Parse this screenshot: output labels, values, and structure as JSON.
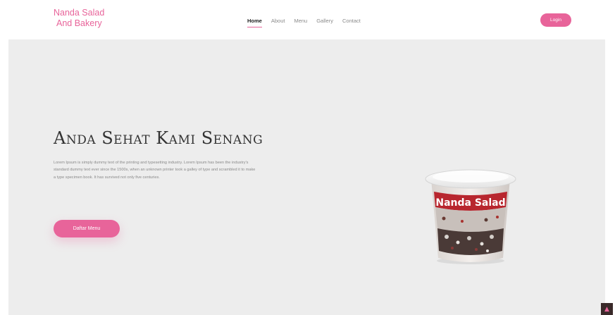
{
  "brand": {
    "line1": "Nanda Salad",
    "line2": "And Bakery"
  },
  "nav": {
    "items": [
      "Home",
      "About",
      "Menu",
      "Gallery",
      "Contact"
    ],
    "active": "Home"
  },
  "header": {
    "login_label": "Login"
  },
  "hero": {
    "headline": "Anda Sehat Kami Senang",
    "description": "Lorem Ipsum is simply dummy text of the printing and typesetting industry. Lorem Ipsum has been the industry's standard dummy text ever since the 1500s, when an unknown printer took a galley of type and scrambled it to make a type specimen book. It has survived not only five centuries.",
    "cta_label": "Daftar Menu",
    "product_label": "Nanda Salad"
  },
  "icons": {
    "scroll_top": "chevron-up-icon"
  },
  "colors": {
    "accent": "#e8649a",
    "hero_bg": "#ededed",
    "header_bg": "#ffffff"
  }
}
